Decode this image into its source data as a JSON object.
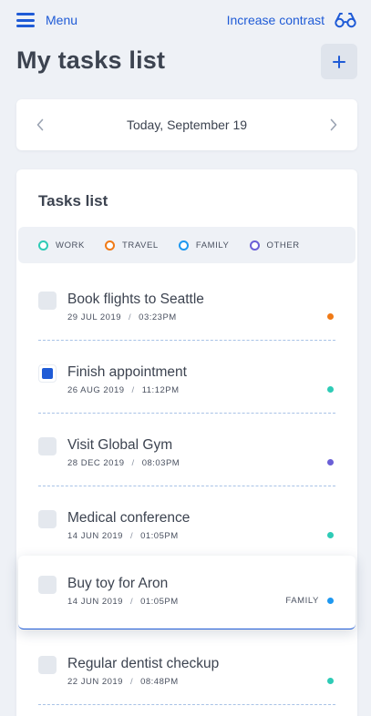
{
  "header": {
    "menu_label": "Menu",
    "contrast_label": "Increase contrast",
    "title": "My tasks list",
    "add_icon": "plus-icon",
    "menu_icon": "hamburger-icon",
    "contrast_icon": "glasses-icon"
  },
  "date_bar": {
    "label": "Today, September 19"
  },
  "tasks_panel": {
    "title": "Tasks list",
    "legend": [
      {
        "label": "WORK",
        "color": "#2ecbb6"
      },
      {
        "label": "TRAVEL",
        "color": "#f07a16"
      },
      {
        "label": "FAMILY",
        "color": "#1e98f0"
      },
      {
        "label": "OTHER",
        "color": "#6a5fd6"
      }
    ],
    "tasks": [
      {
        "title": "Book flights to Seattle",
        "date": "29 JUL 2019",
        "time": "03:23PM",
        "color": "#f07a16",
        "checked": false,
        "category": ""
      },
      {
        "title": "Finish appointment",
        "date": "26 AUG 2019",
        "time": "11:12PM",
        "color": "#2ecbb6",
        "checked": true,
        "category": ""
      },
      {
        "title": "Visit Global Gym",
        "date": "28 DEC 2019",
        "time": "08:03PM",
        "color": "#6a5fd6",
        "checked": false,
        "category": ""
      },
      {
        "title": "Medical conference",
        "date": "14 JUN 2019",
        "time": "01:05PM",
        "color": "#2ecbb6",
        "checked": false,
        "category": ""
      },
      {
        "title": "Buy toy for Aron",
        "date": "14 JUN 2019",
        "time": "01:05PM",
        "color": "#1e98f0",
        "checked": false,
        "category": "FAMILY"
      },
      {
        "title": "Regular dentist checkup",
        "date": "22 JUN 2019",
        "time": "08:48PM",
        "color": "#2ecbb6",
        "checked": false,
        "category": ""
      }
    ]
  },
  "colors": {
    "accent": "#1f5bd6",
    "background": "#eef1f6"
  }
}
